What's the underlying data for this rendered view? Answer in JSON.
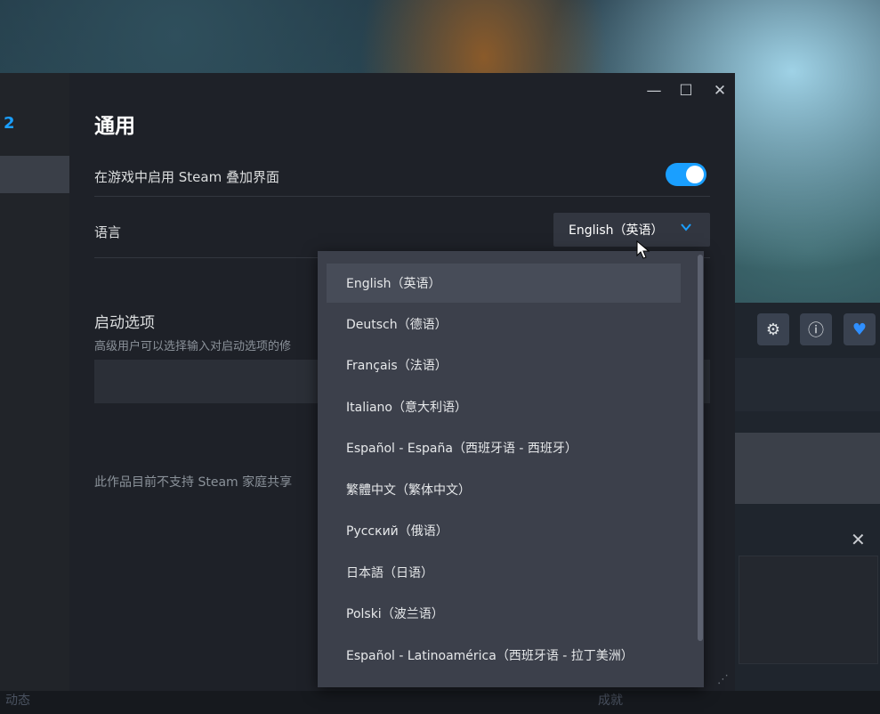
{
  "window": {
    "title": "通用",
    "controls": {
      "minimize": "—",
      "maximize": "☐",
      "close": "✕"
    }
  },
  "sidebar": {
    "visible_number": "2"
  },
  "settings": {
    "overlay_label": "在游戏中启用 Steam 叠加界面",
    "overlay_enabled": true,
    "language_label": "语言",
    "language_selected": "English（英语）",
    "launch_options_title": "启动选项",
    "launch_options_desc": "高级用户可以选择输入对启动选项的修",
    "family_sharing_text": "此作品目前不支持 Steam 家庭共享"
  },
  "dropdown": {
    "options": [
      "English（英语）",
      "Deutsch（德语）",
      "Français（法语）",
      "Italiano（意大利语）",
      "Español - España（西班牙语 - 西班牙）",
      "繁體中文（繁体中文）",
      "Русский（俄语）",
      "日本語（日语）",
      "Polski（波兰语）",
      "Español - Latinoamérica（西班牙语 - 拉丁美洲）"
    ],
    "highlighted_index": 0
  },
  "background": {
    "bottom_left": "动态",
    "bottom_right": "成就"
  },
  "colors": {
    "accent": "#1a9fff",
    "window_bg": "#1e2128",
    "dropdown_bg": "#3c404b"
  },
  "icons": [
    "minimize-icon",
    "maximize-icon",
    "close-icon",
    "chevron-down-icon",
    "gear-icon",
    "info-icon",
    "heart-icon",
    "resize-grip-icon",
    "mouse-cursor-icon"
  ]
}
